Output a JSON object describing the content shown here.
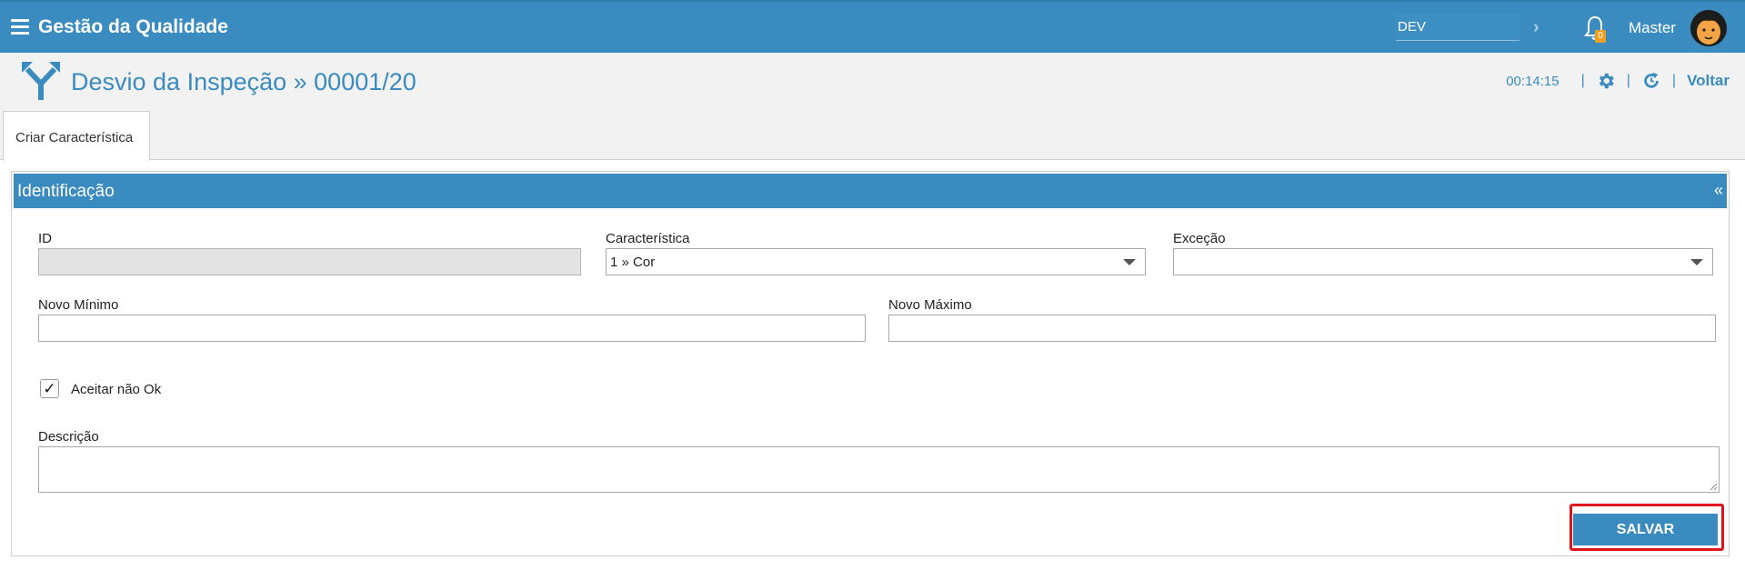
{
  "topbar": {
    "app_title": "Gestão da Qualidade",
    "environment": "DEV",
    "notification_count": "0",
    "user_name": "Master"
  },
  "header": {
    "title": "Desvio da Inspeção » 00001/20",
    "timer": "00:14:15",
    "back_label": "Voltar"
  },
  "tabs": [
    {
      "label": "Criar Característica"
    }
  ],
  "panel": {
    "title": "Identificação",
    "collapse_symbol": "«"
  },
  "form": {
    "id": {
      "label": "ID",
      "value": ""
    },
    "caracteristica": {
      "label": "Característica",
      "value": "1 » Cor"
    },
    "excecao": {
      "label": "Exceção",
      "value": ""
    },
    "novo_minimo": {
      "label": "Novo Mínimo",
      "value": ""
    },
    "novo_maximo": {
      "label": "Novo Máximo",
      "value": ""
    },
    "aceitar_nao_ok": {
      "label": "Aceitar não Ok",
      "checked": true,
      "mark": "✓"
    },
    "descricao": {
      "label": "Descrição",
      "value": ""
    }
  },
  "actions": {
    "save_label": "SALVAR"
  },
  "colors": {
    "primary": "#3a8bbf",
    "highlight": "#e0141e",
    "badge": "#f0a020"
  },
  "icons": [
    "menu-icon",
    "chevron-right-icon",
    "bell-icon",
    "avatar",
    "fork-arrow-icon",
    "gear-icon",
    "refresh-icon",
    "chevron-down-icon"
  ]
}
